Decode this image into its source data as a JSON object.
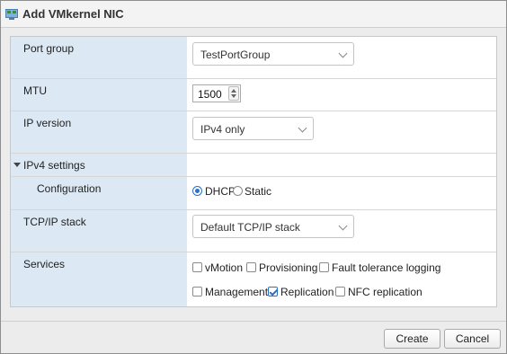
{
  "window": {
    "title": "Add VMkernel NIC"
  },
  "form": {
    "port_group": {
      "label": "Port group",
      "value": "TestPortGroup"
    },
    "mtu": {
      "label": "MTU",
      "value": "1500"
    },
    "ip_version": {
      "label": "IP version",
      "value": "IPv4 only"
    },
    "ipv4_settings": {
      "label": "IPv4 settings"
    },
    "configuration": {
      "label": "Configuration",
      "options": [
        "DHCP",
        "Static"
      ],
      "selected": "DHCP"
    },
    "tcpip_stack": {
      "label": "TCP/IP stack",
      "value": "Default TCP/IP stack"
    },
    "services": {
      "label": "Services",
      "items": [
        {
          "label": "vMotion",
          "checked": false
        },
        {
          "label": "Provisioning",
          "checked": false
        },
        {
          "label": "Fault tolerance logging",
          "checked": false
        },
        {
          "label": "Management",
          "checked": false
        },
        {
          "label": "Replication",
          "checked": true
        },
        {
          "label": "NFC replication",
          "checked": false
        }
      ]
    }
  },
  "buttons": {
    "create": "Create",
    "cancel": "Cancel"
  },
  "colors": {
    "accent": "#2e6fc9",
    "label_bg": "#dce9f5"
  }
}
